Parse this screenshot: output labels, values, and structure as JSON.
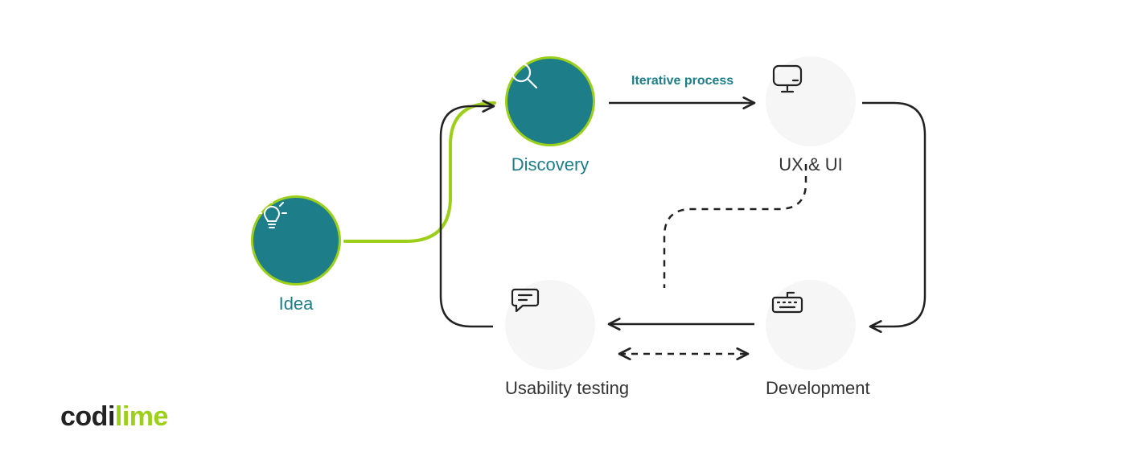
{
  "nodes": {
    "idea": {
      "label": "Idea"
    },
    "discovery": {
      "label": "Discovery"
    },
    "uxui": {
      "label": "UX & UI"
    },
    "usability": {
      "label": "Usability testing"
    },
    "dev": {
      "label": "Development"
    }
  },
  "edge_label": "Iterative process",
  "logo": {
    "part1": "codi",
    "part2": "lime"
  },
  "colors": {
    "teal": "#1d7e8a",
    "lime": "#9bcf1a",
    "stroke": "#222",
    "light_bg": "#f6f6f6"
  }
}
